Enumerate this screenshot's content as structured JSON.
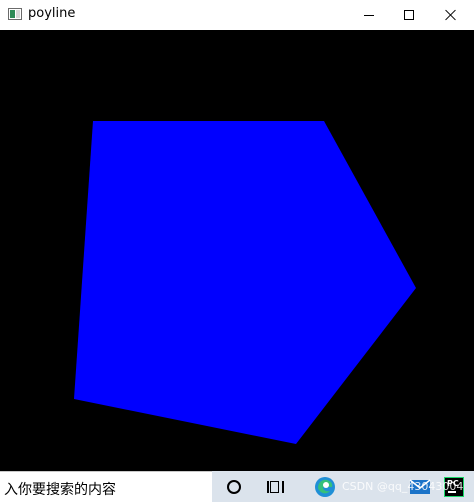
{
  "window": {
    "title": "poyline",
    "app_icon": "app-window-icon",
    "buttons": {
      "minimize_icon": "minimize-icon",
      "maximize_icon": "maximize-icon",
      "close_icon": "close-icon"
    }
  },
  "canvas": {
    "background": "#000000",
    "shape": {
      "type": "filled-polygon",
      "fill": "#0000ff"
    }
  },
  "taskbar": {
    "search_text": "入你要搜索的内容",
    "icons": [
      "cortana-icon",
      "task-view-icon",
      "edge-browser-icon",
      "mail-icon",
      "pycharm-icon"
    ],
    "watermark": "CSDN @qq_43043004"
  }
}
